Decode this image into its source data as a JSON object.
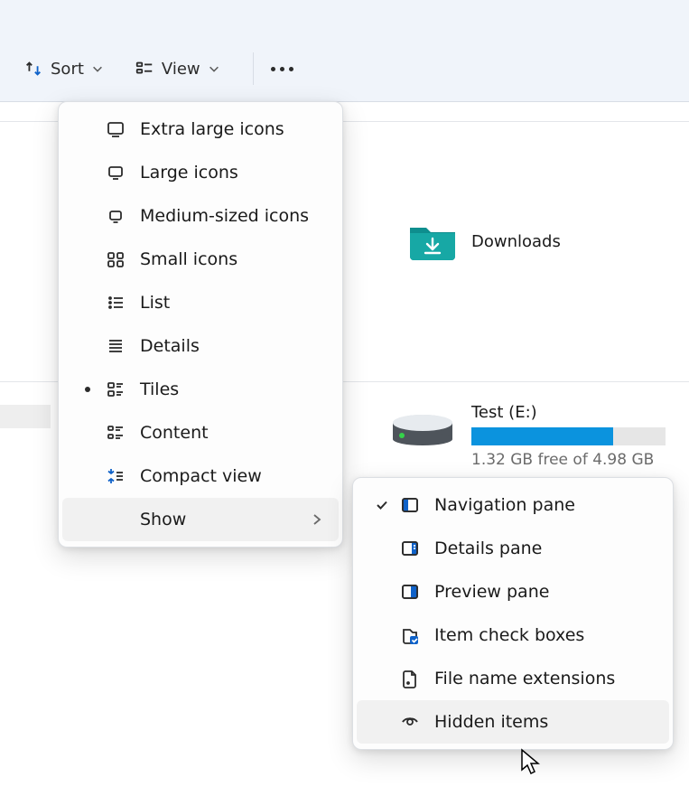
{
  "toolbar": {
    "sort_label": "Sort",
    "view_label": "View"
  },
  "content": {
    "downloads_label": "Downloads",
    "drive": {
      "label": "Test (E:)",
      "free_text": "1.32 GB free of 4.98 GB"
    }
  },
  "view_menu": {
    "items": {
      "extra_large": "Extra large icons",
      "large": "Large icons",
      "medium": "Medium-sized icons",
      "small": "Small icons",
      "list": "List",
      "details": "Details",
      "tiles": "Tiles",
      "content": "Content",
      "compact": "Compact view",
      "show": "Show"
    }
  },
  "show_menu": {
    "items": {
      "nav": "Navigation pane",
      "details_pane": "Details pane",
      "preview_pane": "Preview pane",
      "check_boxes": "Item check boxes",
      "extensions": "File name extensions",
      "hidden": "Hidden items"
    }
  }
}
